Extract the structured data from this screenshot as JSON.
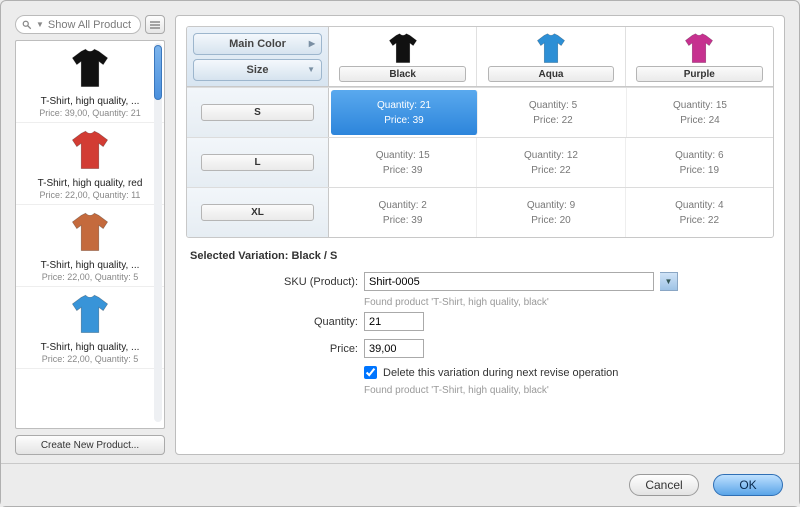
{
  "search": {
    "placeholder": "Show All Product"
  },
  "sidebar": {
    "items": [
      {
        "color": "#111111",
        "name": "T-Shirt, high quality, ...",
        "meta": "Price: 39,00, Quantity: 21"
      },
      {
        "color": "#d23c34",
        "name": "T-Shirt, high quality, red",
        "meta": "Price: 22,00, Quantity: 11"
      },
      {
        "color": "#c46a3d",
        "name": "T-Shirt, high quality, ...",
        "meta": "Price: 22,00, Quantity: 5"
      },
      {
        "color": "#3894d8",
        "name": "T-Shirt, high quality, ...",
        "meta": "Price: 22,00, Quantity: 5"
      }
    ],
    "create_label": "Create New Product..."
  },
  "grid": {
    "axis1": "Main Color",
    "axis2": "Size",
    "columns": [
      {
        "label": "Black",
        "color": "#111111"
      },
      {
        "label": "Aqua",
        "color": "#2d8fd5"
      },
      {
        "label": "Purple",
        "color": "#c6318f"
      }
    ],
    "rows": [
      {
        "label": "S",
        "cells": [
          {
            "qty": "Quantity: 21",
            "price": "Price: 39",
            "selected": true
          },
          {
            "qty": "Quantity: 5",
            "price": "Price: 22"
          },
          {
            "qty": "Quantity: 15",
            "price": "Price: 24"
          }
        ]
      },
      {
        "label": "L",
        "cells": [
          {
            "qty": "Quantity: 15",
            "price": "Price: 39"
          },
          {
            "qty": "Quantity: 12",
            "price": "Price: 22"
          },
          {
            "qty": "Quantity: 6",
            "price": "Price: 19"
          }
        ]
      },
      {
        "label": "XL",
        "cells": [
          {
            "qty": "Quantity: 2",
            "price": "Price: 39"
          },
          {
            "qty": "Quantity: 9",
            "price": "Price: 20"
          },
          {
            "qty": "Quantity: 4",
            "price": "Price: 22"
          }
        ]
      }
    ]
  },
  "form": {
    "selected_title": "Selected Variation: Black / S",
    "sku_label": "SKU (Product):",
    "sku_value": "Shirt-0005",
    "sku_hint": "Found product 'T-Shirt, high quality, black'",
    "qty_label": "Quantity:",
    "qty_value": "21",
    "price_label": "Price:",
    "price_value": "39,00",
    "delete_label": "Delete this variation during next revise operation",
    "delete_hint": "Found product 'T-Shirt, high quality, black'"
  },
  "footer": {
    "cancel": "Cancel",
    "ok": "OK"
  }
}
